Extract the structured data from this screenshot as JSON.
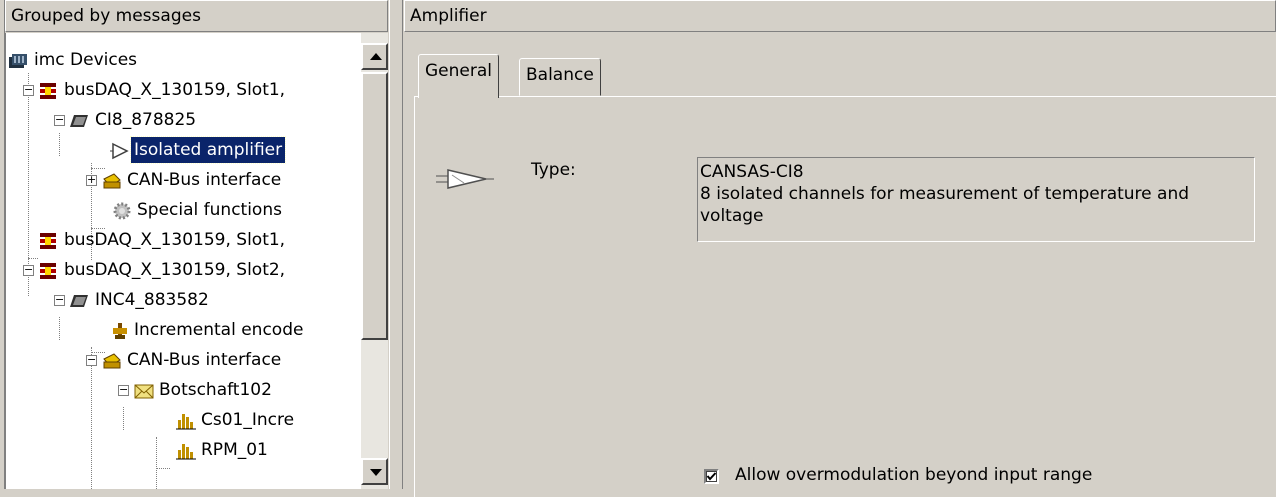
{
  "left_panel": {
    "title": "Grouped by messages"
  },
  "right_panel": {
    "title": "Amplifier"
  },
  "tree": [
    {
      "label": "imc Devices",
      "icon": "devices-icon"
    },
    {
      "label": "busDAQ_X_130159, Slot1,",
      "icon": "busdaq-icon"
    },
    {
      "label": "CI8_878825",
      "icon": "module-icon"
    },
    {
      "label": "Isolated amplifier",
      "icon": "amplifier-icon",
      "selected": true
    },
    {
      "label": "CAN-Bus interface",
      "icon": "can-bus-icon"
    },
    {
      "label": "Special functions",
      "icon": "gear-icon"
    },
    {
      "label": "busDAQ_X_130159, Slot1,",
      "icon": "busdaq-icon"
    },
    {
      "label": "busDAQ_X_130159, Slot2,",
      "icon": "busdaq-icon"
    },
    {
      "label": "INC4_883582",
      "icon": "module-icon"
    },
    {
      "label": "Incremental encode",
      "icon": "encoder-icon"
    },
    {
      "label": "CAN-Bus interface",
      "icon": "can-bus-icon"
    },
    {
      "label": "Botschaft102",
      "icon": "envelope-icon"
    },
    {
      "label": "Cs01_Incre",
      "icon": "channel-icon"
    },
    {
      "label": "RPM_01",
      "icon": "channel-icon"
    }
  ],
  "tabs": [
    {
      "label": "General",
      "active": true
    },
    {
      "label": "Balance",
      "active": false
    }
  ],
  "general": {
    "type_label": "Type:",
    "type_value_line1": "CANSAS-CI8",
    "type_value_line2": "8 isolated channels for measurement of temperature and",
    "type_value_line3": "voltage",
    "overmodulation_label": "Allow overmodulation beyond input range",
    "overmodulation_checked": true
  },
  "colors": {
    "face": "#d4d0c8",
    "selection": "#0a246a"
  }
}
